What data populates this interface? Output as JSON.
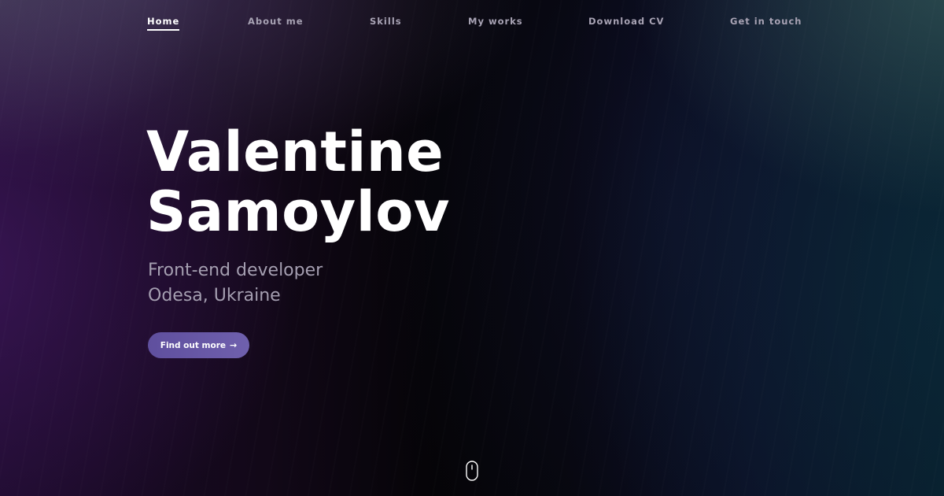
{
  "nav": {
    "items": [
      {
        "label": "Home",
        "active": true
      },
      {
        "label": "About me",
        "active": false
      },
      {
        "label": "Skills",
        "active": false
      },
      {
        "label": "My works",
        "active": false
      },
      {
        "label": "Download CV",
        "active": false
      },
      {
        "label": "Get in touch",
        "active": false
      }
    ]
  },
  "hero": {
    "name_line1": "Valentine",
    "name_line2": "Samoylov",
    "role": "Front-end developer",
    "location": "Odesa, Ukraine",
    "cta_label": "Find out more",
    "cta_icon": "arrow-right-icon",
    "cta_arrow": "→"
  },
  "scroll_indicator": {
    "icon": "mouse-scroll-icon"
  },
  "colors": {
    "accent": "#6a5aa8",
    "text_primary": "#ffffff",
    "text_muted": "#a59fb1"
  }
}
